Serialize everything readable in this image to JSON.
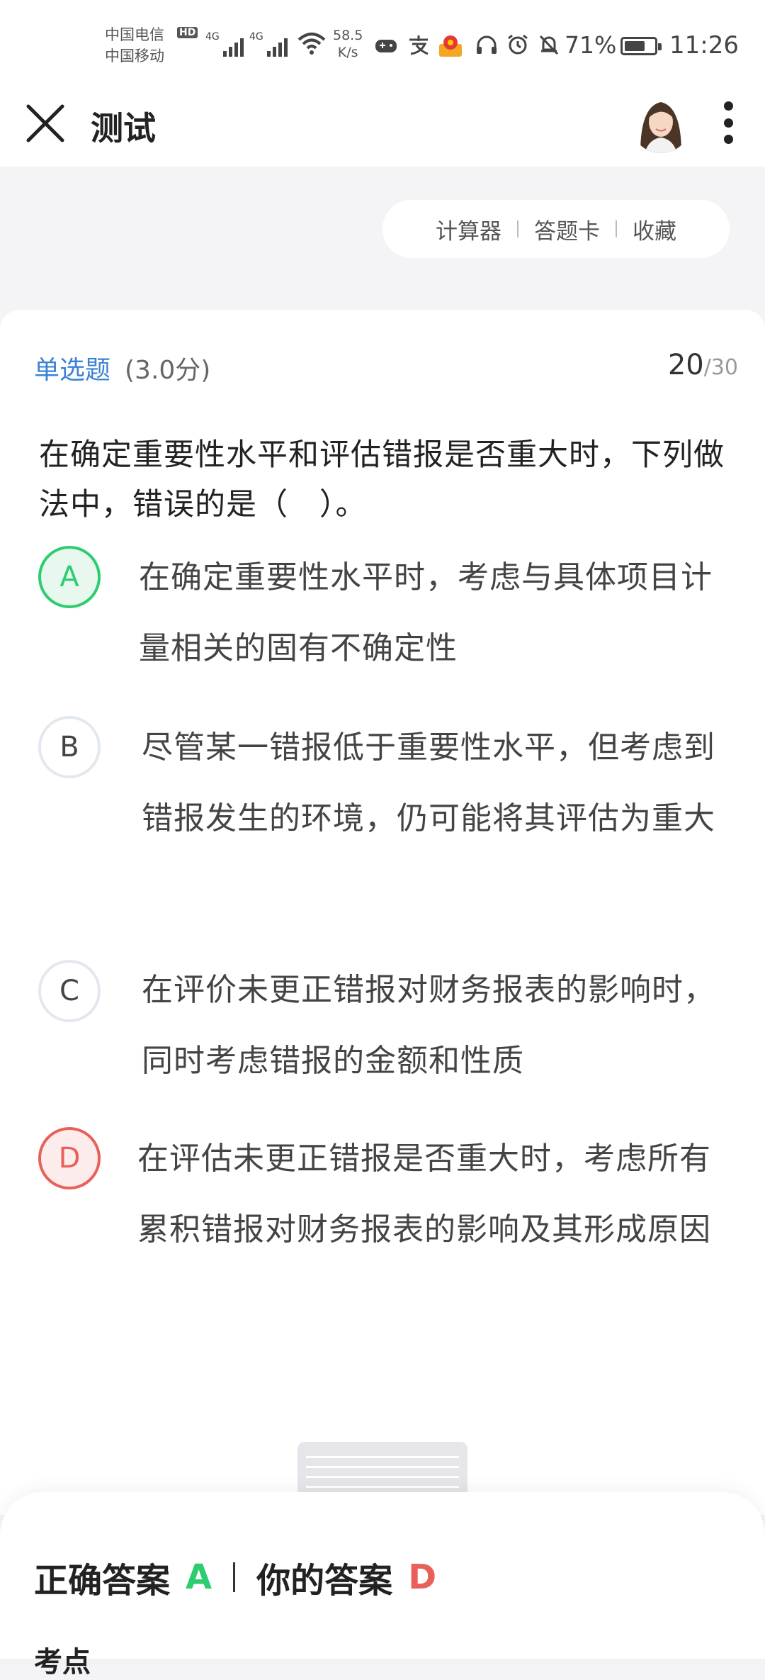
{
  "status_bar": {
    "carrier1": "中国电信",
    "carrier2": "中国移动",
    "hd": "HD",
    "net1": "4G",
    "net2": "4G",
    "speed_value": "58.5",
    "speed_unit": "K/s",
    "battery_pct": "71%",
    "battery_level": 0.71,
    "time": "11:26"
  },
  "header": {
    "title": "测试"
  },
  "tools": {
    "calculator": "计算器",
    "answer_card": "答题卡",
    "favorite": "收藏"
  },
  "question": {
    "type": "单选题",
    "score": "(3.0分)",
    "current": "20",
    "total": "/30",
    "stem": "在确定重要性水平和评估错报是否重大时，下列做法中，错误的是（　）。",
    "options": [
      {
        "letter": "A",
        "text": "在确定重要性水平时，考虑与具体项目计量相关的固有不确定性",
        "state": "correct"
      },
      {
        "letter": "B",
        "text": "尽管某一错报低于重要性水平，但考虑到错报发生的环境，仍可能将其评估为重大",
        "state": "normal"
      },
      {
        "letter": "C",
        "text": "在评价未更正错报对财务报表的影响时，同时考虑错报的金额和性质",
        "state": "normal"
      },
      {
        "letter": "D",
        "text": "在评估未更正错报是否重大时，考虑所有累积错报对财务报表的影响及其形成原因",
        "state": "wrong"
      }
    ]
  },
  "answer": {
    "correct_label": "正确答案",
    "correct_value": "A",
    "yours_label": "你的答案",
    "yours_value": "D",
    "section_label": "考点"
  },
  "colors": {
    "correct": "#2ecc71",
    "wrong": "#e9605a",
    "accent": "#3b82d6"
  }
}
